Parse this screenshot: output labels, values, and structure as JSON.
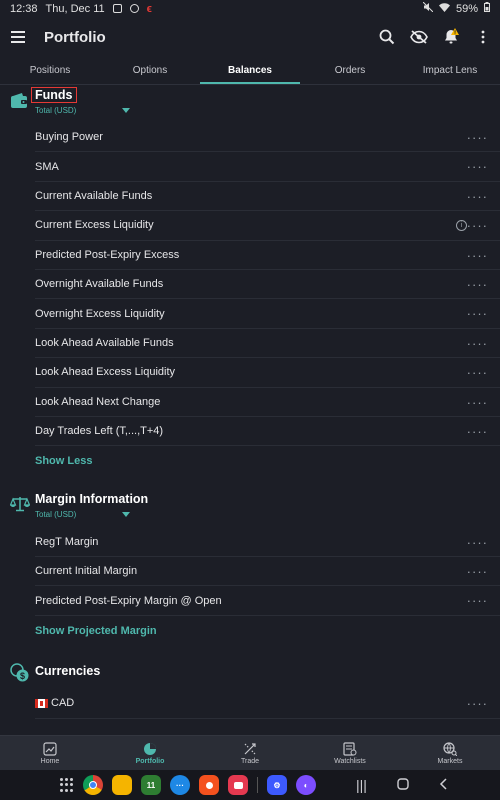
{
  "status_bar": {
    "time": "12:38",
    "date": "Thu, Dec 11",
    "battery": "59%"
  },
  "header": {
    "title": "Portfolio"
  },
  "tabs": [
    {
      "label": "Positions"
    },
    {
      "label": "Options"
    },
    {
      "label": "Balances",
      "active": true
    },
    {
      "label": "Orders"
    },
    {
      "label": "Impact Lens"
    }
  ],
  "funds": {
    "title": "Funds",
    "subtitle": "Total (USD)",
    "rows": [
      "Buying Power",
      "SMA",
      "Current Available Funds",
      "Current Excess Liquidity",
      "Predicted Post-Expiry Excess",
      "Overnight Available Funds",
      "Overnight Excess Liquidity",
      "Look Ahead Available Funds",
      "Look Ahead Excess Liquidity",
      "Look Ahead Next Change",
      "Day Trades Left (T,...,T+4)"
    ],
    "show_less": "Show Less"
  },
  "margin": {
    "title": "Margin Information",
    "subtitle": "Total (USD)",
    "rows": [
      "RegT Margin",
      "Current Initial Margin",
      "Predicted Post-Expiry Margin @ Open"
    ],
    "show_projected": "Show Projected Margin"
  },
  "currencies": {
    "title": "Currencies",
    "rows": [
      "CAD"
    ]
  },
  "bottom_nav": [
    {
      "label": "Home",
      "icon": "chart-icon"
    },
    {
      "label": "Portfolio",
      "icon": "pie-icon",
      "active": true
    },
    {
      "label": "Trade",
      "icon": "trade-icon"
    },
    {
      "label": "Watchlists",
      "icon": "watchlist-icon"
    },
    {
      "label": "Markets",
      "icon": "globe-icon"
    }
  ],
  "dock": {
    "calendar_day": "11"
  },
  "colors": {
    "accent": "#4fb8ad",
    "background": "#1c1e26",
    "highlight_box": "#e53935"
  }
}
